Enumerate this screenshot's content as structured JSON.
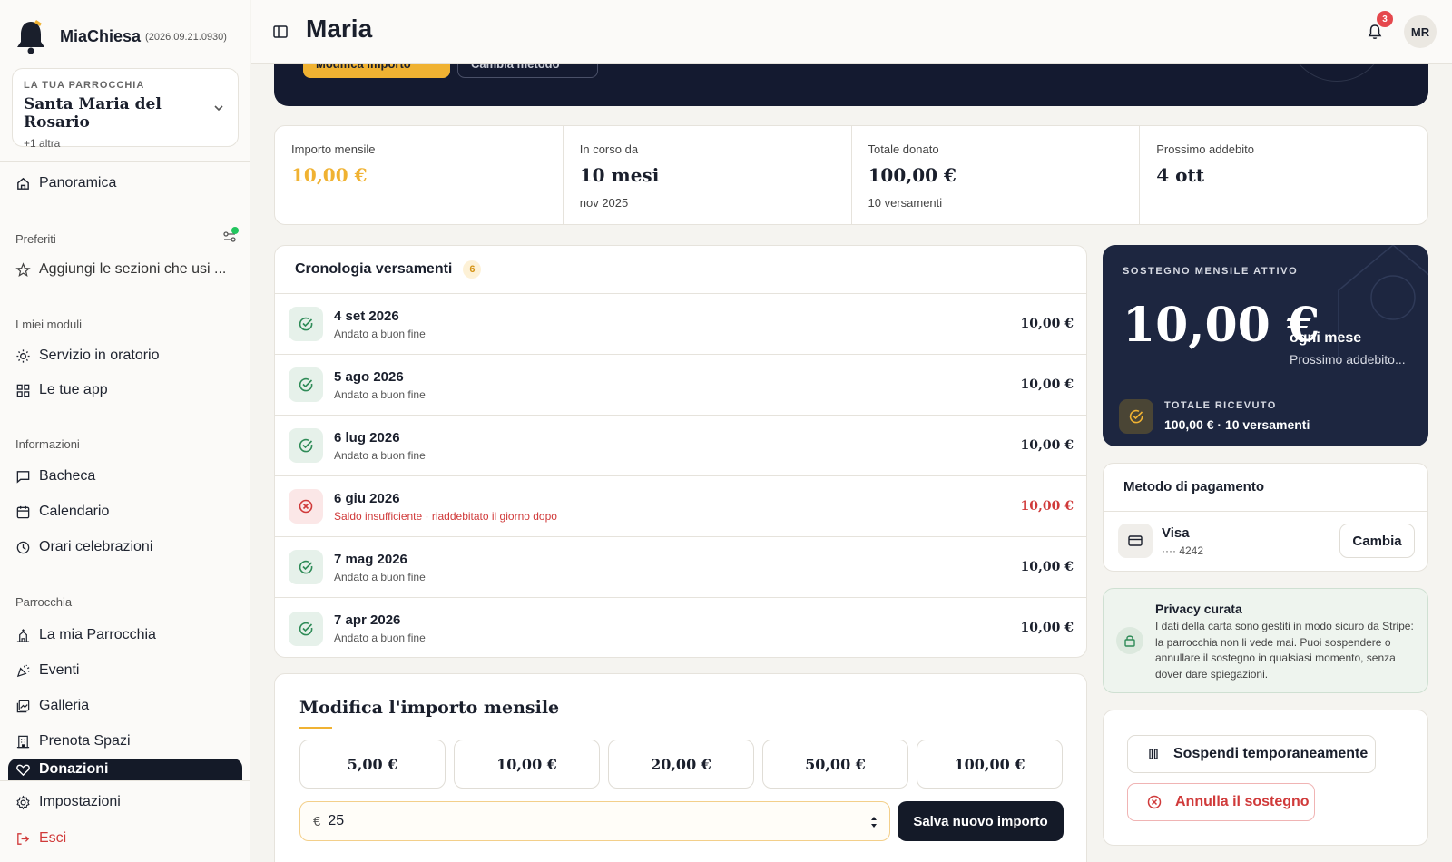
{
  "app": {
    "name": "MiaChiesa",
    "version": "(2026.09.21.0930)"
  },
  "parish": {
    "label": "LA TUA PARROCCHIA",
    "name": "Santa Maria del Rosario",
    "more": "+1 altra"
  },
  "sidebar": {
    "overview": "Panoramica",
    "favorites_label": "Preferiti",
    "favorites_add": "Aggiungi le sezioni che usi ...",
    "modules_label": "I miei moduli",
    "modules": [
      "Servizio in oratorio",
      "Le tue app"
    ],
    "info_label": "Informazioni",
    "info": [
      "Bacheca",
      "Calendario",
      "Orari celebrazioni"
    ],
    "parish_label": "Parrocchia",
    "parish_items": [
      "La mia Parrocchia",
      "Eventi",
      "Galleria",
      "Prenota Spazi",
      "Donazioni"
    ],
    "settings": "Impostazioni",
    "logout": "Esci"
  },
  "topbar": {
    "title": "Maria",
    "notifications": "3",
    "avatar": "MR"
  },
  "hero": {
    "edit_amount": "Modifica importo",
    "change_method": "Cambia metodo"
  },
  "stats": [
    {
      "label": "Importo mensile",
      "value": "10,00 €",
      "sub": ""
    },
    {
      "label": "In corso da",
      "value": "10 mesi",
      "sub": "nov 2025"
    },
    {
      "label": "Totale donato",
      "value": "100,00 €",
      "sub": "10 versamenti"
    },
    {
      "label": "Prossimo addebito",
      "value": "4 ott",
      "sub": ""
    }
  ],
  "history": {
    "title": "Cronologia versamenti",
    "count": "6",
    "rows": [
      {
        "date": "4 set 2026",
        "status": "Andato a buon fine",
        "amount": "10,00 €",
        "ok": true
      },
      {
        "date": "5 ago 2026",
        "status": "Andato a buon fine",
        "amount": "10,00 €",
        "ok": true
      },
      {
        "date": "6 lug 2026",
        "status": "Andato a buon fine",
        "amount": "10,00 €",
        "ok": true
      },
      {
        "date": "6 giu 2026",
        "status": "Saldo insufficiente · riaddebitato il giorno dopo",
        "amount": "10,00 €",
        "ok": false
      },
      {
        "date": "7 mag 2026",
        "status": "Andato a buon fine",
        "amount": "10,00 €",
        "ok": true
      },
      {
        "date": "7 apr 2026",
        "status": "Andato a buon fine",
        "amount": "10,00 €",
        "ok": true
      }
    ]
  },
  "modify": {
    "title": "Modifica l'importo mensile",
    "options": [
      "5,00 €",
      "10,00 €",
      "20,00 €",
      "50,00 €",
      "100,00 €"
    ],
    "currency": "€",
    "value": "25",
    "save": "Salva nuovo importo"
  },
  "support": {
    "label": "SOSTEGNO MENSILE ATTIVO",
    "amount": "10,00 €",
    "period": "ogni mese",
    "next": "Prossimo addebito...",
    "total_label": "TOTALE RICEVUTO",
    "total_value": "100,00 € · 10 versamenti"
  },
  "payment": {
    "title": "Metodo di pagamento",
    "brand": "Visa",
    "number": "···· 4242",
    "change": "Cambia"
  },
  "privacy": {
    "title": "Privacy curata",
    "body": "I dati della carta sono gestiti in modo sicuro da Stripe: la parrocchia non li vede mai. Puoi sospendere o annullare il sostegno in qualsiasi momento, senza dover dare spiegazioni."
  },
  "actions": {
    "pause": "Sospendi temporaneamente",
    "cancel": "Annulla il sostegno"
  },
  "colors": {
    "accent": "#f0b232",
    "dark": "#141a28",
    "error": "#d03a3a",
    "success": "#2e8b57"
  }
}
